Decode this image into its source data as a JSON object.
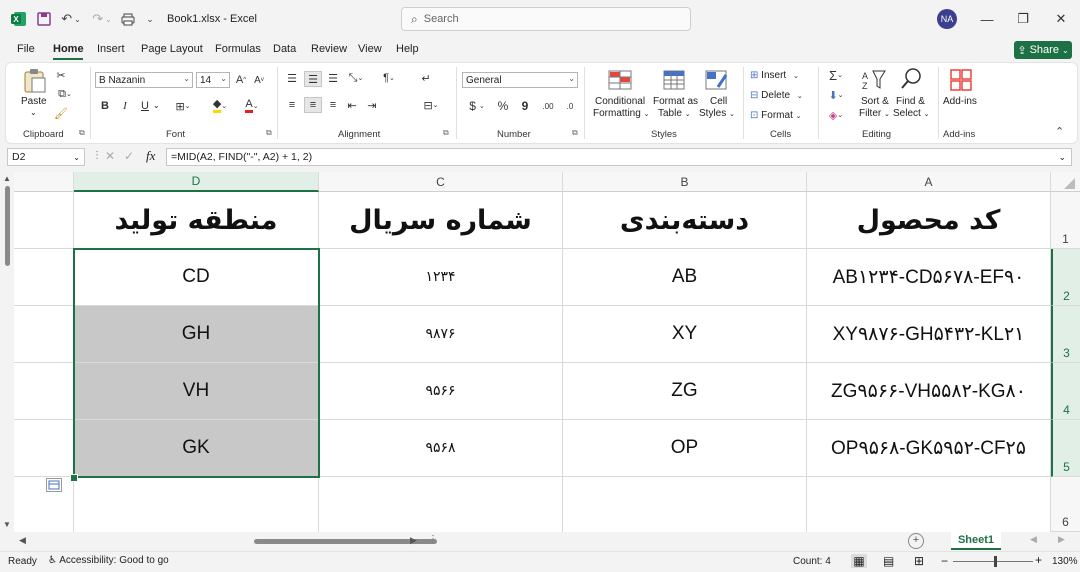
{
  "titlebar": {
    "filename": "Book1.xlsx",
    "separator": "-",
    "app": "Excel",
    "search_placeholder": "Search",
    "user_initials": "NA"
  },
  "menu": [
    "File",
    "Home",
    "Insert",
    "Page Layout",
    "Formulas",
    "Data",
    "Review",
    "View",
    "Help"
  ],
  "share_label": "Share",
  "ribbon": {
    "clipboard": {
      "paste": "Paste",
      "label": "Clipboard"
    },
    "font": {
      "name": "B Nazanin",
      "size": "14",
      "label": "Font",
      "bold": "B",
      "italic": "I",
      "underline": "U"
    },
    "alignment": {
      "label": "Alignment"
    },
    "number": {
      "format": "General",
      "label": "Number",
      "currency": "$",
      "percent": "%",
      "comma": "9"
    },
    "styles": {
      "conditional_1": "Conditional",
      "conditional_2": "Formatting",
      "format_as_1": "Format as",
      "format_as_2": "Table",
      "cell_styles_1": "Cell",
      "cell_styles_2": "Styles",
      "label": "Styles"
    },
    "cells": {
      "insert": "Insert",
      "delete": "Delete",
      "format": "Format",
      "label": "Cells"
    },
    "editing": {
      "sort_1": "Sort &",
      "sort_2": "Filter",
      "find_1": "Find &",
      "find_2": "Select",
      "label": "Editing"
    },
    "addins": {
      "button": "Add-ins",
      "label": "Add-ins"
    }
  },
  "formula_bar": {
    "name_box": "D2",
    "fx": "fx",
    "formula": "=MID(A2, FIND(\"-\", A2) + 1, 2)"
  },
  "grid": {
    "columns": [
      "A",
      "B",
      "C",
      "D"
    ],
    "rows": [
      "1",
      "2",
      "3",
      "4",
      "5",
      "6"
    ],
    "headers": {
      "A": "کد محصول",
      "B": "دسته‌بندی",
      "C": "شماره سریال",
      "D": "منطقه تولید"
    },
    "data": [
      {
        "A": "AB۱۲۳۴-CD۵۶۷۸-EF۹۰",
        "B": "AB",
        "C": "۱۲۳۴",
        "D": "CD"
      },
      {
        "A": "XY۹۸۷۶-GH۵۴۳۲-KL۲۱",
        "B": "XY",
        "C": "۹۸۷۶",
        "D": "GH"
      },
      {
        "A": "ZG۹۵۶۶-VH۵۵۸۲-KG۸۰",
        "B": "ZG",
        "C": "۹۵۶۶",
        "D": "VH"
      },
      {
        "A": "OP۹۵۶۸-GK۵۹۵۲-CF۲۵",
        "B": "OP",
        "C": "۹۵۶۸",
        "D": "GK"
      }
    ]
  },
  "sheets": {
    "active": "Sheet1"
  },
  "status": {
    "ready": "Ready",
    "accessibility": "Accessibility: Good to go",
    "count": "Count: 4",
    "zoom": "130%"
  },
  "colors": {
    "accent": "#1e7145",
    "selection_fill": "#c8c8c8"
  }
}
